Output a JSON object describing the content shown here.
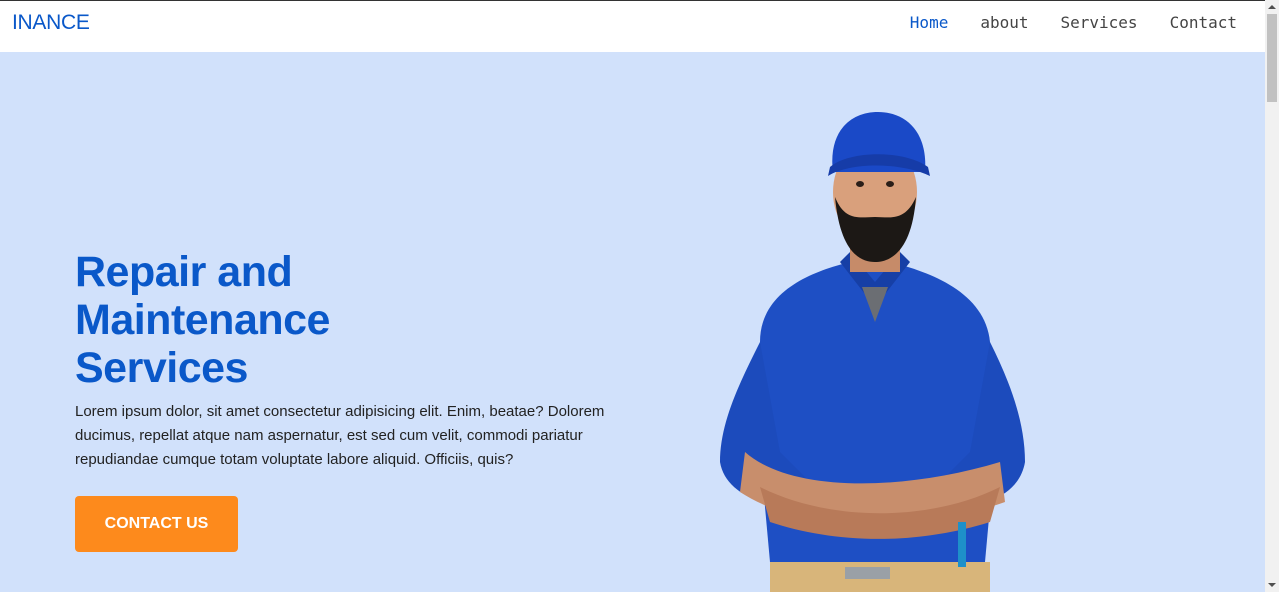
{
  "header": {
    "brand": "INANCE",
    "nav": [
      {
        "label": "Home",
        "active": true
      },
      {
        "label": "about",
        "active": false
      },
      {
        "label": "Services",
        "active": false
      },
      {
        "label": "Contact",
        "active": false
      }
    ]
  },
  "hero": {
    "title_line1": "Repair and",
    "title_line2": "Maintenance",
    "title_line3": "Services",
    "description": "Lorem ipsum dolor, sit amet consectetur adipisicing elit. Enim, beatae? Dolorem ducimus, repellat atque nam aspernatur, est sed cum velit, commodi pariatur repudiandae cumque totam voluptate labore aliquid. Officiis, quis?",
    "cta_label": "CONTACT US",
    "image": "repairman-illustration"
  },
  "colors": {
    "brand": "#0a58c9",
    "hero_bg": "#d1e1fb",
    "cta": "#fd8a1c"
  }
}
